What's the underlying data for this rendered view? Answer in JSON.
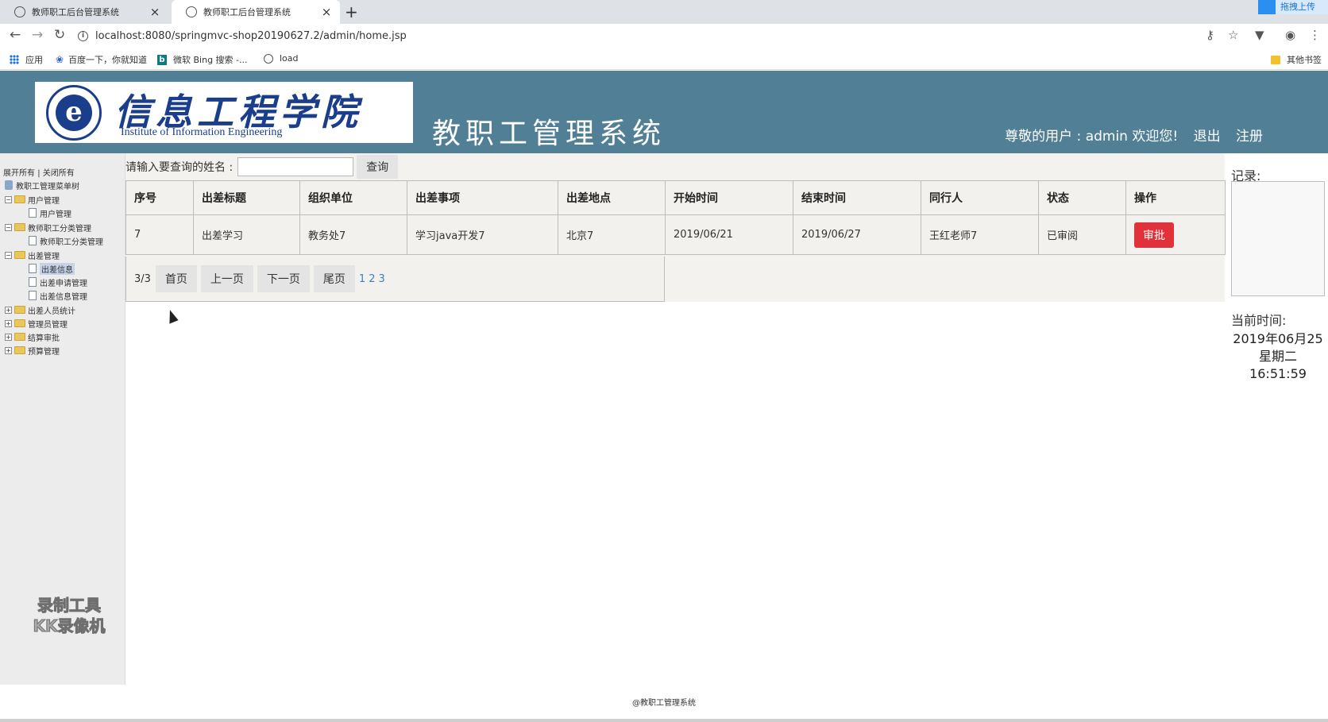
{
  "browser": {
    "tabs": [
      {
        "title": "教师职工后台管理系统"
      },
      {
        "title": "教师职工后台管理系统"
      }
    ],
    "url": "localhost:8080/springmvc-shop20190627.2/admin/home.jsp",
    "widget_label": "拖拽上传",
    "bookmarks": [
      "应用",
      "百度一下，你就知道",
      "微软 Bing 搜索 -...",
      "load"
    ],
    "other_bookmarks": "其他书签"
  },
  "header": {
    "logo_cn": "信息工程学院",
    "logo_en": "Institute of Information Engineering",
    "system_title": "教职工管理系统",
    "welcome": "尊敬的用户 : admin 欢迎您!",
    "logout": "退出",
    "register": "注册"
  },
  "sidebar": {
    "expand_all": "展开所有",
    "separator": "|",
    "collapse_all": "关闭所有",
    "root": "教职工管理菜单树",
    "items": [
      {
        "label": "用户管理"
      },
      {
        "label": "用户管理"
      },
      {
        "label": "教师职工分类管理"
      },
      {
        "label": "教师职工分类管理"
      },
      {
        "label": "出差管理"
      },
      {
        "label": "出差信息"
      },
      {
        "label": "出差申请管理"
      },
      {
        "label": "出差信息管理"
      },
      {
        "label": "出差人员统计"
      },
      {
        "label": "管理员管理"
      },
      {
        "label": "结算审批"
      },
      {
        "label": "预算管理"
      }
    ],
    "watermark_line1": "录制工具",
    "watermark_line2": "KK录像机"
  },
  "search": {
    "label": "请输入要查询的姓名 :",
    "value": "",
    "button": "查询"
  },
  "table": {
    "headers": [
      "序号",
      "出差标题",
      "组织单位",
      "出差事项",
      "出差地点",
      "开始时间",
      "结束时间",
      "同行人",
      "状态",
      "操作"
    ],
    "rows": [
      {
        "id": "7",
        "title": "出差学习",
        "org": "教务处7",
        "matter": "学习java开发7",
        "place": "北京7",
        "start": "2019/06/21",
        "end": "2019/06/27",
        "companion": "王红老师7",
        "status": "已审阅",
        "action": "审批"
      }
    ]
  },
  "pager": {
    "info": "3/3",
    "first": "首页",
    "prev": "上一页",
    "next": "下一页",
    "last": "尾页",
    "pages": [
      "1",
      "2",
      "3"
    ]
  },
  "right_panel": {
    "record_label": "记录:",
    "time_label": "当前时间:",
    "date": "2019年06月25",
    "weekday": "星期二",
    "time": "16:51:59"
  },
  "footer": "@教职工管理系统",
  "colors": {
    "header_bg": "#507f96",
    "approve_button": "#e1313a",
    "logo_blue": "#1b3e8c"
  }
}
